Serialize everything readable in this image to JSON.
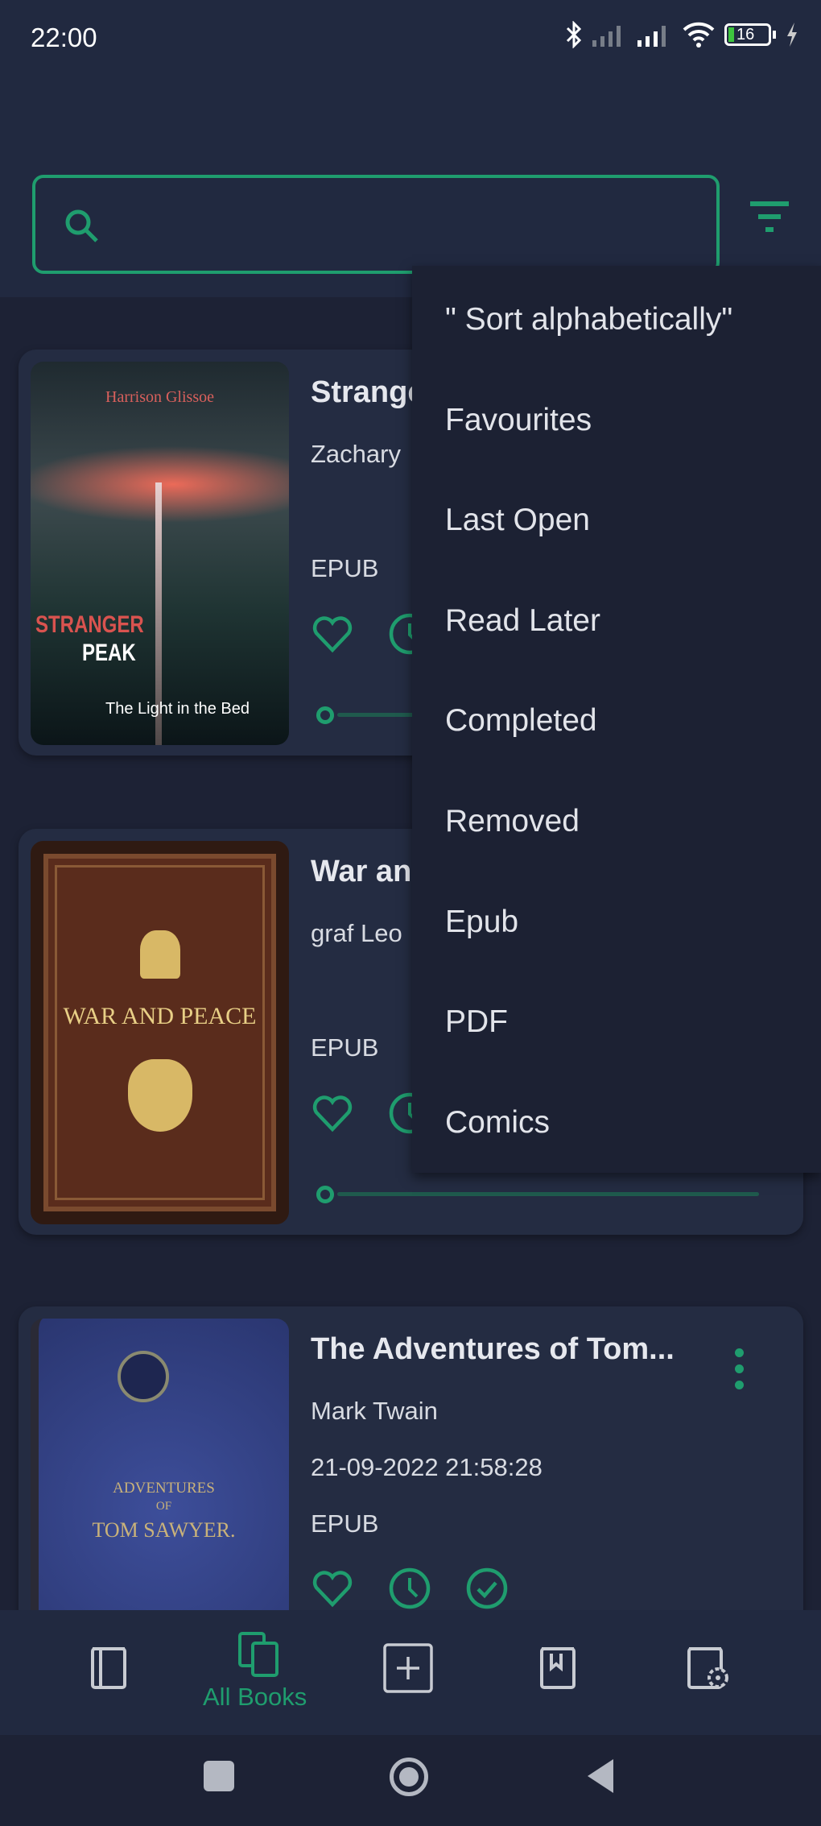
{
  "status_bar": {
    "time": "22:00",
    "battery": "16",
    "icons": [
      "bluetooth-icon",
      "signal-icon",
      "signal-icon",
      "wifi-icon",
      "battery-icon",
      "charging-icon"
    ]
  },
  "search": {
    "placeholder": "",
    "value": ""
  },
  "colors": {
    "accent": "#1f9d6e",
    "background": "#1d2235",
    "card": "#242c42",
    "menu": "#1c2133"
  },
  "sort_menu": {
    "items": [
      "\" Sort alphabetically\"",
      "Favourites",
      "Last Open",
      "Read Later",
      "Completed",
      "Removed",
      "Epub",
      "PDF",
      "Comics"
    ]
  },
  "books": [
    {
      "title": "Stranger Peak",
      "author": "Zachary",
      "date": "",
      "format": "EPUB",
      "progress": 0,
      "cover": {
        "author": "Harrison Glissoe",
        "title1": "STRANGER",
        "title2": "PEAK",
        "subtitle": "The Light in the Bed"
      }
    },
    {
      "title": "War and Peace",
      "author": "graf Leo",
      "date": "",
      "format": "EPUB",
      "progress": 0,
      "cover": {
        "title": "WAR AND PEACE"
      }
    },
    {
      "title": "The Adventures of Tom...",
      "author": "Mark Twain",
      "date": "21-09-2022 21:58:28",
      "format": "EPUB",
      "cover": {
        "title1": "ADVENTURES",
        "title2": "OF",
        "title3": "TOM SAWYER."
      }
    }
  ],
  "bottom_nav": {
    "active": "All Books",
    "items": [
      {
        "icon": "book-icon"
      },
      {
        "icon": "books-icon",
        "label": "All Books"
      },
      {
        "icon": "add-book-icon"
      },
      {
        "icon": "bookmark-book-icon"
      },
      {
        "icon": "book-settings-icon"
      }
    ]
  }
}
